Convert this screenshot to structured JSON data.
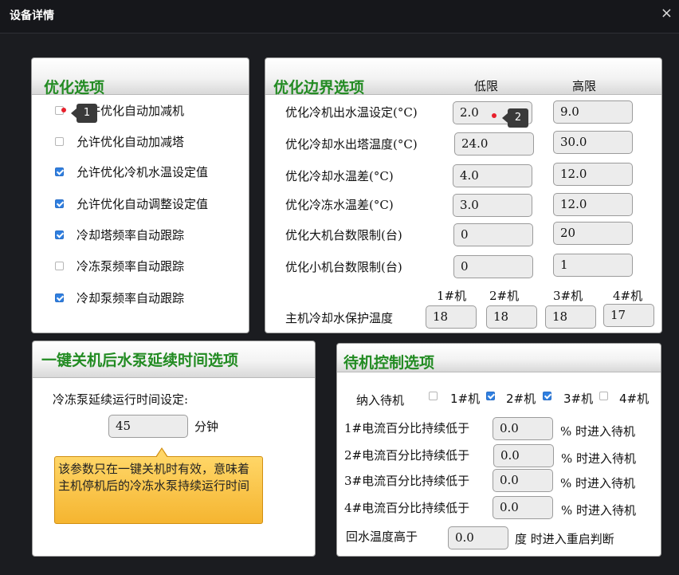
{
  "window": {
    "title": "设备详情",
    "close_icon": "×"
  },
  "optimize_options": {
    "title": "优化选项",
    "items": [
      {
        "label": "允许优化自动加减机",
        "checked": false
      },
      {
        "label": "允许优化自动加减塔",
        "checked": false
      },
      {
        "label": "允许优化冷机水温设定值",
        "checked": true
      },
      {
        "label": "允许优化自动调整设定值",
        "checked": true
      },
      {
        "label": "冷却塔频率自动跟踪",
        "checked": true
      },
      {
        "label": "冷冻泵频率自动跟踪",
        "checked": false
      },
      {
        "label": "冷却泵频率自动跟踪",
        "checked": true
      }
    ]
  },
  "boundary_options": {
    "title": "优化边界选项",
    "low_header": "低限",
    "high_header": "高限",
    "rows": [
      {
        "label": "优化冷机出水温设定(°C)",
        "low": "2.0",
        "high": "9.0"
      },
      {
        "label": "优化冷却水出塔温度(°C)",
        "low": "24.0",
        "high": "30.0"
      },
      {
        "label": "优化冷却水温差(°C)",
        "low": "4.0",
        "high": "12.0"
      },
      {
        "label": "优化冷冻水温差(°C)",
        "low": "3.0",
        "high": "12.0"
      },
      {
        "label": "优化大机台数限制(台)",
        "low": "0",
        "high": "20"
      },
      {
        "label": "优化小机台数限制(台)",
        "low": "0",
        "high": "1"
      }
    ],
    "protect_label": "主机冷却水保护温度",
    "machines": [
      "1#机",
      "2#机",
      "3#机",
      "4#机"
    ],
    "protect_values": [
      "18",
      "18",
      "18",
      "17"
    ]
  },
  "pump_delay": {
    "title": "一键关机后水泵延续时间选项",
    "label": "冷冻泵延续运行时间设定:",
    "value": "45",
    "unit": "分钟",
    "tooltip": "该参数只在一键关机时有效，意味着主机停机后的冷冻水泵持续运行时间"
  },
  "standby": {
    "title": "待机控制选项",
    "include_label": "纳入待机",
    "machines": [
      {
        "label": "1#机",
        "checked": false
      },
      {
        "label": "2#机",
        "checked": true
      },
      {
        "label": "3#机",
        "checked": true
      },
      {
        "label": "4#机",
        "checked": false
      }
    ],
    "rows": [
      {
        "label": "1#电流百分比持续低于",
        "value": "0.0",
        "suffix": "% 时进入待机"
      },
      {
        "label": "2#电流百分比持续低于",
        "value": "0.0",
        "suffix": "% 时进入待机"
      },
      {
        "label": "3#电流百分比持续低于",
        "value": "0.0",
        "suffix": "% 时进入待机"
      },
      {
        "label": "4#电流百分比持续低于",
        "value": "0.0",
        "suffix": "% 时进入待机"
      }
    ],
    "return_label": "回水温度高于",
    "return_value": "0.0",
    "return_suffix": "度 时进入重启判断"
  },
  "annotations": [
    "1",
    "2"
  ],
  "colors": {
    "title_green": "#228b22",
    "check_blue": "#2f7fe0",
    "marker_red": "#e8202c",
    "tooltip_orange": "#f5b530"
  }
}
